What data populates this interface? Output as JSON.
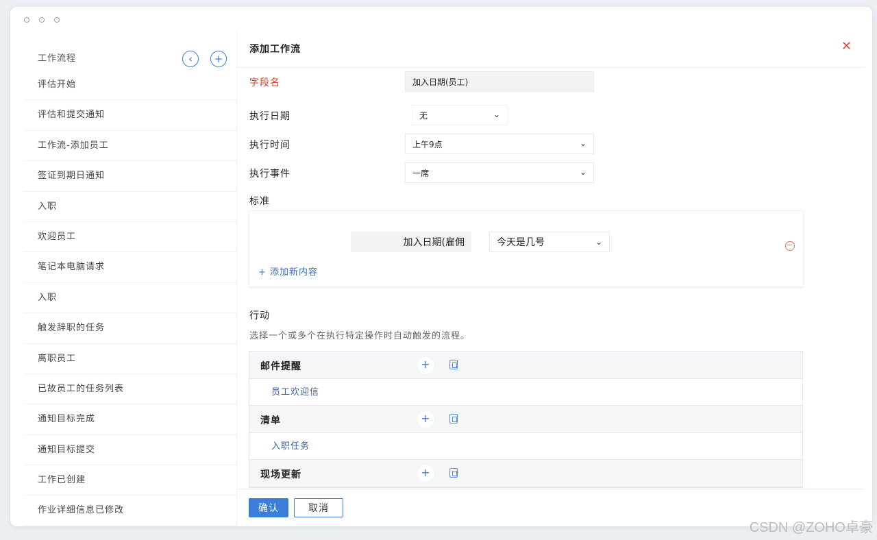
{
  "sidebar": {
    "header": "工作流程",
    "prev_icon": "‹",
    "add_icon": "+",
    "items": [
      {
        "label": "评估开始"
      },
      {
        "label": "评估和提交通知"
      },
      {
        "label": "工作流-添加员工"
      },
      {
        "label": "签证到期日通知"
      },
      {
        "label": "入职"
      },
      {
        "label": "欢迎员工"
      },
      {
        "label": "笔记本电脑请求"
      },
      {
        "label": "入职"
      },
      {
        "label": "触发辞职的任务"
      },
      {
        "label": "离职员工"
      },
      {
        "label": "已故员工的任务列表"
      },
      {
        "label": "通知目标完成"
      },
      {
        "label": "通知目标提交"
      },
      {
        "label": "工作已创建"
      },
      {
        "label": "作业详细信息已修改"
      }
    ]
  },
  "panel": {
    "title": "添加工作流",
    "close_icon": "✕",
    "field_name_label": "字段名",
    "field_name_value": "加入日期(员工)",
    "exec_date_label": "执行日期",
    "exec_date_value": "无",
    "exec_time_label": "执行时间",
    "exec_time_value": "上午9点",
    "exec_event_label": "执行事件",
    "exec_event_value": "一席",
    "criteria_label": "标准",
    "criteria_field": "加入日期(雇佣",
    "criteria_operator": "今天是几号",
    "add_new_label": "+ 添加新内容",
    "actions_label": "行动",
    "actions_desc": "选择一个或多个在执行特定操作时自动触发的流程。",
    "action_groups": [
      {
        "name": "邮件提醒",
        "sub": "员工欢迎信"
      },
      {
        "name": "清单",
        "sub": "入职任务"
      },
      {
        "name": "现场更新",
        "sub": ""
      }
    ],
    "confirm_label": "确认",
    "cancel_label": "取消"
  },
  "watermark": "CSDN @ZOHO卓豪",
  "colors": {
    "accent": "#3b7ddb",
    "danger": "#d9412e"
  }
}
